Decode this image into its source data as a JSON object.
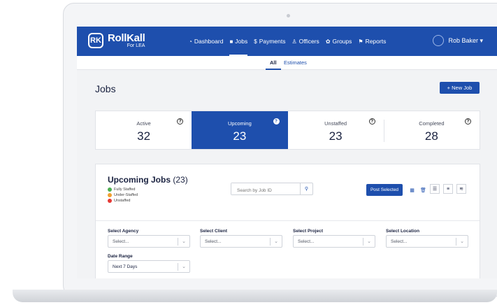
{
  "brand": {
    "name": "RollKall",
    "sub": "For LEA",
    "mark": "RK"
  },
  "nav": {
    "items": [
      {
        "label": "Dashboard",
        "icon": "◔"
      },
      {
        "label": "Jobs",
        "icon": "■"
      },
      {
        "label": "Payments",
        "icon": "$"
      },
      {
        "label": "Officers",
        "icon": "♙"
      },
      {
        "label": "Groups",
        "icon": "✿"
      },
      {
        "label": "Reports",
        "icon": "⚑"
      }
    ],
    "user": "Rob Baker ▾"
  },
  "subnav": {
    "all": "All",
    "estimates": "Estimates"
  },
  "page": {
    "title": "Jobs",
    "new_job": "+ New Job"
  },
  "stats": [
    {
      "label": "Active",
      "value": "32"
    },
    {
      "label": "Upcoming",
      "value": "23"
    },
    {
      "label": "Unstaffed",
      "value": "23"
    },
    {
      "label": "Completed",
      "value": "28"
    }
  ],
  "help_glyph": "?",
  "panel": {
    "title": "Upcoming Jobs",
    "count": "(23)",
    "legend": [
      {
        "label": "Fully Staffed",
        "color": "#4caf50"
      },
      {
        "label": "Under-Staffed",
        "color": "#f0a030"
      },
      {
        "label": "Unstaffed",
        "color": "#e53935"
      }
    ],
    "search_placeholder": "Search by Job ID",
    "search_icon": "⚲",
    "post_selected": "Post Selected",
    "filters": {
      "agency": {
        "label": "Select Agency",
        "value": "Select..."
      },
      "client": {
        "label": "Select Client",
        "value": "Select..."
      },
      "project": {
        "label": "Select Project",
        "value": "Select..."
      },
      "location": {
        "label": "Select Location",
        "value": "Select..."
      },
      "date": {
        "label": "Date Range",
        "value": "Next 7 Days"
      }
    },
    "caret": "⌄"
  },
  "colors": {
    "primary": "#1e4fad"
  }
}
